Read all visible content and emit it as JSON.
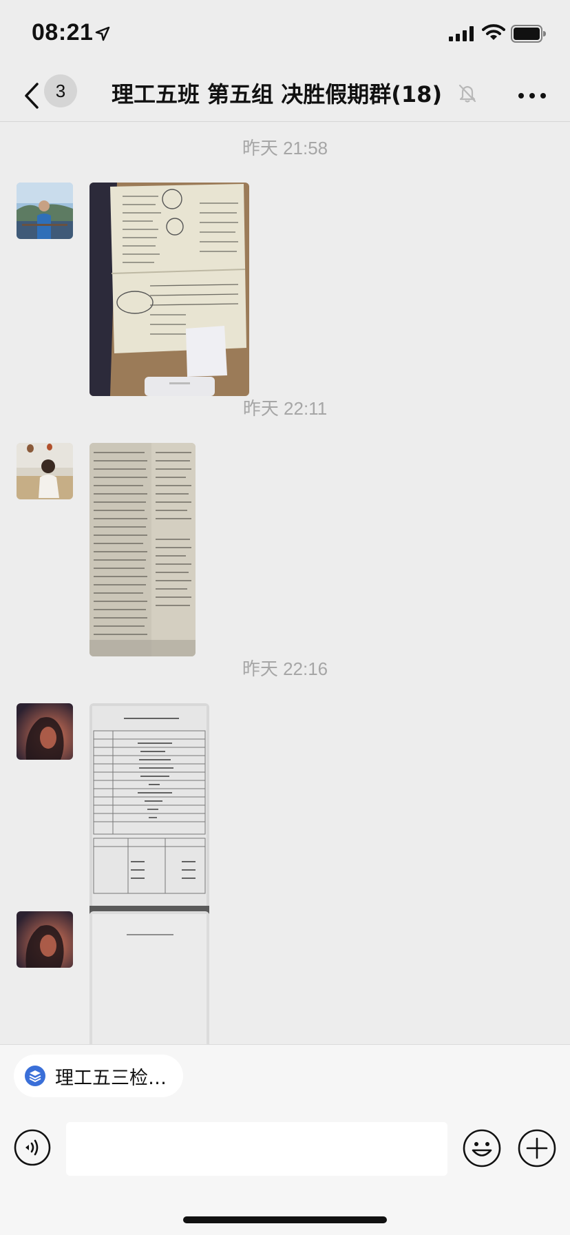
{
  "status_bar": {
    "time": "08:21"
  },
  "nav": {
    "unread_count": "3",
    "title": "理工五班 第五组 决胜假期群(18)"
  },
  "messages": [
    {
      "timestamp": "昨天 21:58",
      "content": "photo-notebook"
    },
    {
      "timestamp": "昨天 22:11",
      "content": "photo-textbook"
    },
    {
      "timestamp": "昨天 22:16",
      "content": "photo-todo-list"
    },
    {
      "timestamp": "",
      "content": "photo-sheet"
    }
  ],
  "mini_program": {
    "label": "理工五三检…"
  },
  "input": {
    "placeholder": ""
  },
  "colors": {
    "background": "#ededed",
    "timestamp": "#a6a6a6",
    "accent": "#3a6fd8"
  },
  "icons": [
    "location-arrow-icon",
    "signal-icon",
    "wifi-icon",
    "battery-icon",
    "back-chevron-icon",
    "mute-bell-icon",
    "more-icon",
    "voice-icon",
    "emoji-icon",
    "add-icon"
  ]
}
